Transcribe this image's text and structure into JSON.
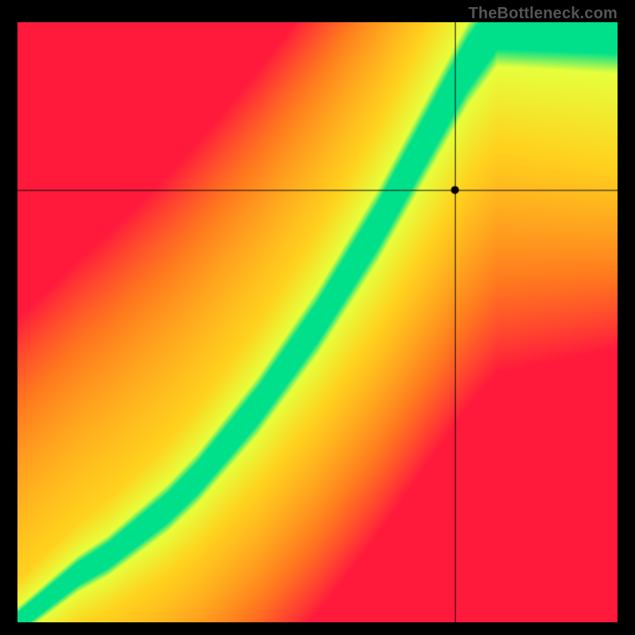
{
  "watermark": "TheBottleneck.com",
  "chart_data": {
    "type": "heatmap",
    "title": "",
    "xlabel": "",
    "ylabel": "",
    "xlim": [
      0,
      1
    ],
    "ylim": [
      0,
      1
    ],
    "crosshair": {
      "x": 0.73,
      "y": 0.72
    },
    "marker": {
      "x": 0.73,
      "y": 0.72,
      "shape": "circle",
      "color": "#000000"
    },
    "optimal_curve": {
      "comment": "Green ridge midline; y_optimal as a function of x (fractions of plot)",
      "x": [
        0.0,
        0.05,
        0.1,
        0.15,
        0.2,
        0.25,
        0.3,
        0.35,
        0.4,
        0.45,
        0.5,
        0.55,
        0.6,
        0.65,
        0.7,
        0.75,
        0.8,
        0.85
      ],
      "y": [
        0.0,
        0.04,
        0.08,
        0.11,
        0.15,
        0.19,
        0.24,
        0.3,
        0.36,
        0.43,
        0.5,
        0.58,
        0.66,
        0.75,
        0.84,
        0.93,
        1.0,
        1.0
      ]
    },
    "color_stops": {
      "comment": "Gradient from far-below-ridge to far-above-ridge (signed distance)",
      "below_far": "#ff1a3c",
      "below_mid": "#ff7a1e",
      "near_outer": "#ffd21e",
      "near_inner": "#e6ff3c",
      "on_ridge": "#00e08b",
      "above_mid": "#ffd21e",
      "above_far": "#ff1a3c"
    },
    "ridge_half_width_base": 0.025,
    "ridge_half_width_growth": 0.06
  }
}
